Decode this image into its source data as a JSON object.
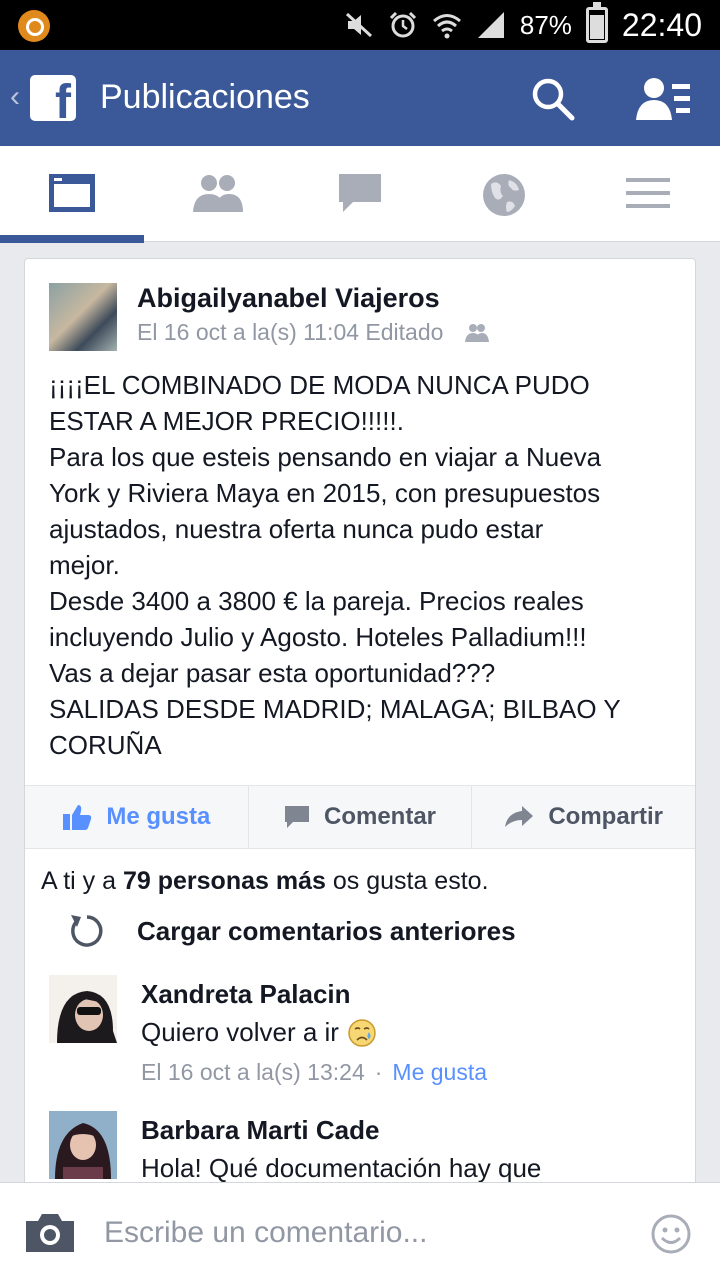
{
  "status_bar": {
    "battery": "87%",
    "time": "22:40"
  },
  "app_bar": {
    "title": "Publicaciones",
    "logo_letter": "f",
    "back": "‹"
  },
  "tabs": [
    {
      "name": "news-feed",
      "active": true
    },
    {
      "name": "friends",
      "active": false
    },
    {
      "name": "messages",
      "active": false
    },
    {
      "name": "notifications",
      "active": false
    },
    {
      "name": "more",
      "active": false
    }
  ],
  "post": {
    "author": "Abigailyanabel Viajeros",
    "meta": "El 16 oct a la(s) 11:04 Editado",
    "body_lines": [
      "¡¡¡¡EL COMBINADO DE MODA NUNCA PUDO",
      "ESTAR A MEJOR PRECIO!!!!!.",
      "Para los que esteis pensando en viajar a Nueva",
      "York y Riviera Maya en 2015, con presupuestos",
      "ajustados, nuestra oferta nunca pudo estar",
      "mejor.",
      "Desde 3400 a 3800 € la pareja. Precios reales",
      "incluyendo Julio y Agosto. Hoteles Palladium!!!",
      "Vas a dejar pasar esta oportunidad???",
      "SALIDAS DESDE MADRID; MALAGA; BILBAO Y",
      "CORUÑA"
    ],
    "actions": {
      "like": "Me gusta",
      "comment": "Comentar",
      "share": "Compartir"
    },
    "likes": {
      "prefix": "A ti y a",
      "bold": "79 personas más",
      "suffix": "os gusta esto."
    },
    "load_previous": "Cargar comentarios anteriores"
  },
  "comments": [
    {
      "name": "Xandreta Palacin",
      "text": "Quiero volver a ir",
      "time": "El 16 oct a la(s) 13:24",
      "separator": "·",
      "like": "Me gusta"
    },
    {
      "name": "Barbara Marti Cade",
      "text": "Hola! Qué documentación hay que"
    }
  ],
  "composer": {
    "placeholder": "Escribe un comentario..."
  },
  "colors": {
    "brand": "#3b5998",
    "link": "#5890ff",
    "muted": "#9197a3",
    "text": "#141823"
  }
}
